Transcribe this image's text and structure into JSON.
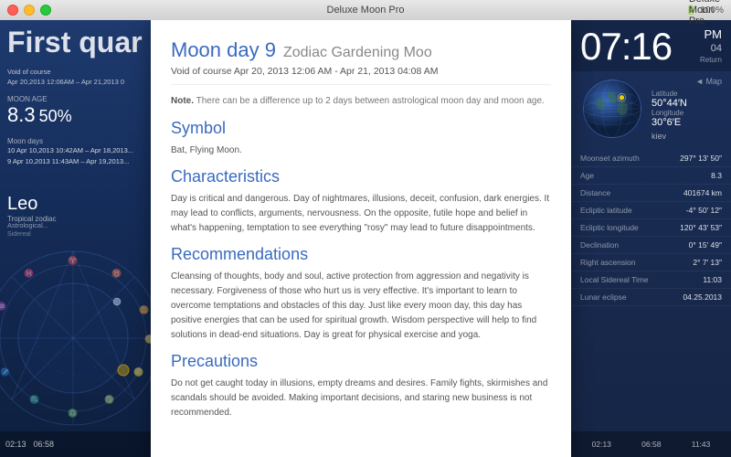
{
  "titlebar": {
    "title": "Deluxe Moon Pro",
    "app_name": "Deluxe Moon Pro"
  },
  "left_panel": {
    "phase_label": "First quar",
    "void_course": "Void of course",
    "void_date": "Apr 20,2013  12:06AM – Apr 21,2013  0",
    "moon_age_label": "Moon age",
    "moon_age_num": "8.3",
    "moon_pct": "50%",
    "moon_days_label": "Moon days",
    "moon_day_1": "10  Apr 10,2013  10:42AM – Apr 18,2013...",
    "moon_day_2": "9   Apr 10,2013  11:43AM – Apr 19,2013...",
    "zodiac_sign": "Leo",
    "zodiac_sub": "Tropical zodiac",
    "astro_label": "Astrological..."
  },
  "modal": {
    "title": "Moon day 9",
    "subtitle": "Zodiac Gardening Moo",
    "void_course_line": "Void of course Apr 20, 2013 12:06 AM - Apr 21, 2013 04:08 AM",
    "note_label": "Note.",
    "note_text": "There can be a difference up to 2 days between astrological moon day and moon age.",
    "symbol_title": "Symbol",
    "symbol_body": "Bat, Flying Moon.",
    "characteristics_title": "Characteristics",
    "characteristics_body": "Day is critical and dangerous. Day of nightmares, illusions, deceit, confusion, dark energies. It may lead to conflicts, arguments, nervousness. On the opposite, futile hope and belief in what's happening, temptation to see everything \"rosy\" may lead to future disappointments.",
    "recommendations_title": "Recommendations",
    "recommendations_body": "Cleansing of thoughts, body and soul, active protection from aggression and negativity is necessary. Forgiveness of those who hurt us is very effective. It's important to learn to overcome temptations and obstacles of this day. Just like every moon day, this day has positive energies that can be used for spiritual growth. Wisdom perspective will help to find solutions in dead-end situations. Day is great for physical exercise and yoga.",
    "precautions_title": "Precautions",
    "precautions_body": "Do not get caught today in illusions, empty dreams and desires. Family fights, skirmishes and scandals should be avoided. Making important decisions, and staring new business is not recommended."
  },
  "right_panel": {
    "time": "07:16",
    "ampm": "PM",
    "date": "04",
    "return_label": "Return",
    "map_label": "◄ Map",
    "latitude_label": "Latitude",
    "latitude_value": "50°44′N",
    "longitude_label": "Longitude",
    "longitude_value": "30°6′E",
    "city": "kiev",
    "data_rows": [
      {
        "label": "Moonset azimuth",
        "value": "297° 13′ 50″"
      },
      {
        "label": "Age",
        "value": "8.3"
      },
      {
        "label": "Distance",
        "value": "401674 km"
      },
      {
        "label": "Ecliptic latitude",
        "value": "-4° 50′ 12″"
      },
      {
        "label": "Ecliptic longitude",
        "value": "120° 43′ 53″"
      },
      {
        "label": "Declination",
        "value": "0° 15′ 49″"
      },
      {
        "label": "Right ascension",
        "value": "2° 7′ 13″"
      },
      {
        "label": "Local Sidereal Time",
        "value": "11:03"
      }
    ],
    "lunar_eclipse_label": "Lunar eclipse",
    "lunar_eclipse_value": "04.25.2013"
  },
  "bottom_bar": {
    "time1": "02:13",
    "time2": "06:58",
    "time3": "11:43"
  }
}
